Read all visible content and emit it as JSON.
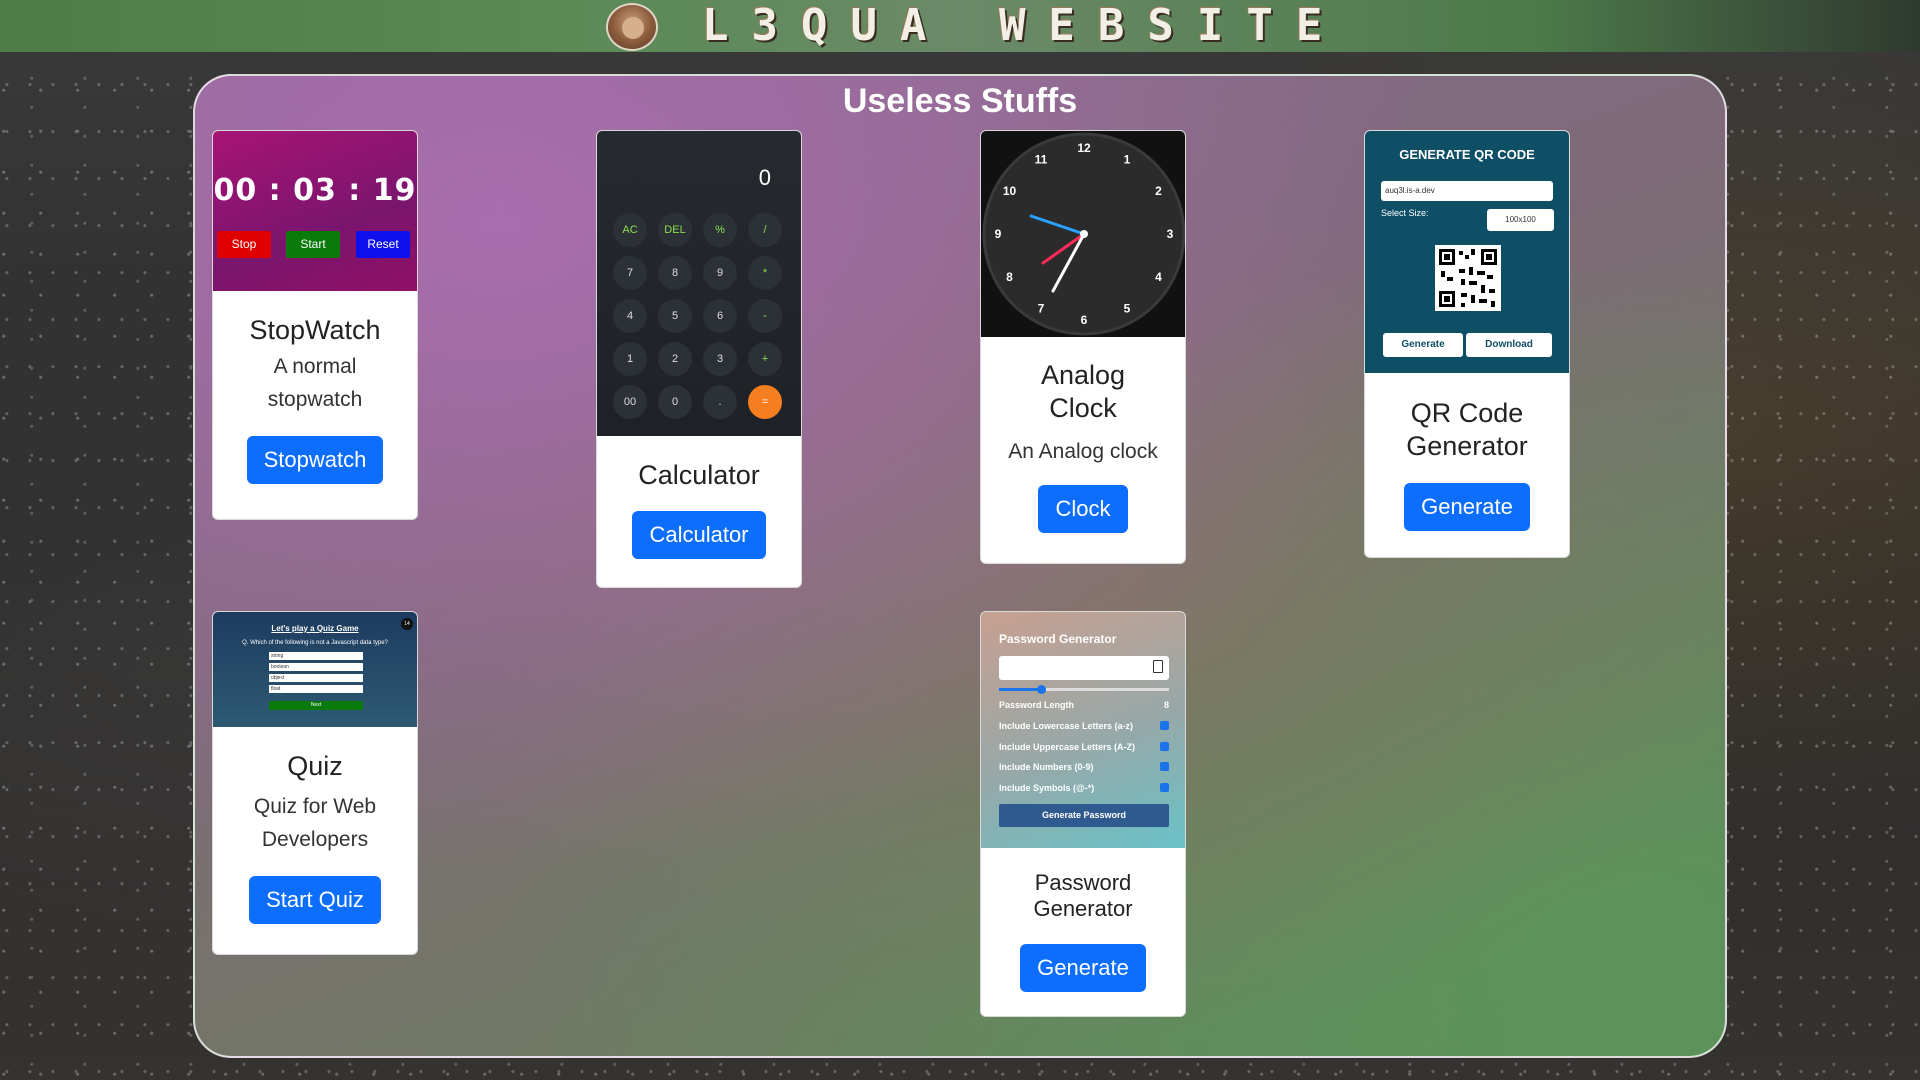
{
  "header": {
    "site_title": "L3QUA WEBSITE",
    "logo_icon": "avatar-logo-icon"
  },
  "panel": {
    "title": "Useless Stuffs"
  },
  "cards": {
    "stopwatch": {
      "preview": {
        "time": "00 : 03 : 19",
        "stop": "Stop",
        "start": "Start",
        "reset": "Reset"
      },
      "title": "StopWatch",
      "desc": "A normal stopwatch",
      "button": "Stopwatch"
    },
    "calculator": {
      "preview": {
        "display": "0",
        "keys": [
          "AC",
          "DEL",
          "%",
          "/",
          "7",
          "8",
          "9",
          "*",
          "4",
          "5",
          "6",
          "-",
          "1",
          "2",
          "3",
          "+",
          "00",
          "0",
          ".",
          "="
        ]
      },
      "title": "Calculator",
      "button": "Calculator"
    },
    "clock": {
      "preview": {
        "numbers": [
          "12",
          "1",
          "2",
          "3",
          "4",
          "5",
          "6",
          "7",
          "8",
          "9",
          "10",
          "11"
        ]
      },
      "title": "Analog Clock",
      "desc": "An Analog clock",
      "button": "Clock"
    },
    "qr": {
      "preview": {
        "heading": "GENERATE QR CODE",
        "input_value": "auq3l.is-a.dev",
        "size_label": "Select Size:",
        "size_value": "100x100",
        "generate": "Generate",
        "download": "Download"
      },
      "title": "QR Code Generator",
      "button": "Generate"
    },
    "quiz": {
      "preview": {
        "heading": "Let's play a Quiz Game",
        "question": "Q. Which of the following is not a Javascript data type?",
        "options": [
          "string",
          "boolean",
          "object",
          "float"
        ],
        "next": "Next",
        "badge": "14"
      },
      "title": "Quiz",
      "desc": "Quiz for Web Developers",
      "button": "Start Quiz"
    },
    "password": {
      "preview": {
        "heading": "Password Generator",
        "length_label": "Password Length",
        "length_value": "8",
        "opt1": "Include Lowercase Letters (a-z)",
        "opt2": "Include Uppercase Letters (A-Z)",
        "opt3": "Include Numbers (0-9)",
        "opt4": "Include Symbols (@-*)",
        "generate": "Generate Password"
      },
      "title": "Password Generator",
      "button": "Generate"
    }
  },
  "colors": {
    "primary_button": "#0d6efd",
    "stop": "#e00000",
    "start": "#0a7a0a",
    "reset": "#1010ee",
    "calc_equals": "#f57e20"
  }
}
